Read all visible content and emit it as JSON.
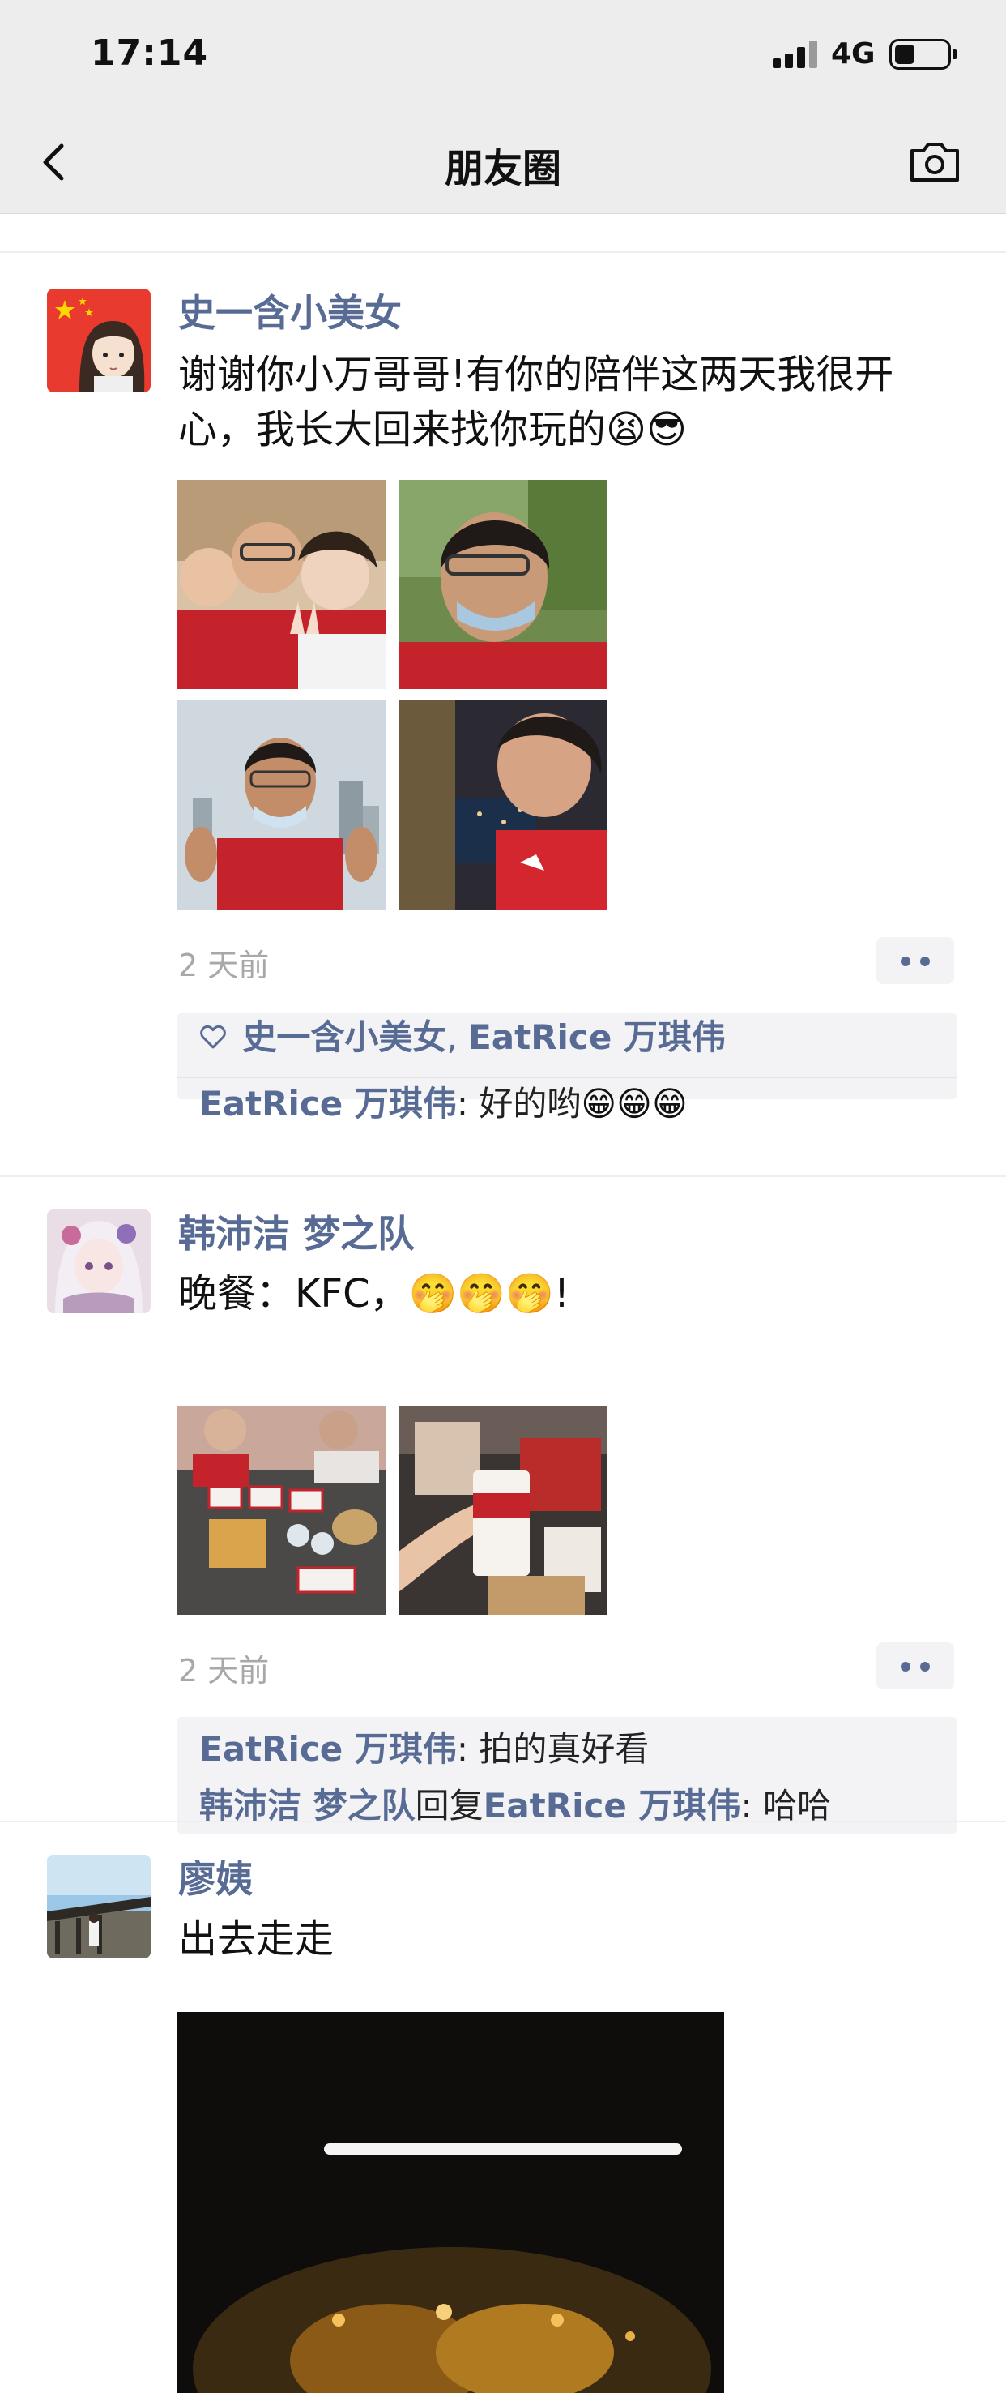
{
  "status_bar": {
    "time": "17:14",
    "network": "4G"
  },
  "nav": {
    "title": "朋友圈"
  },
  "posts": [
    {
      "name": "史一含小美女",
      "text_line1": "谢谢你小万哥哥!有你的陪伴这两天我很开",
      "text_line2": "心，我长大回来找你玩的😫😎",
      "time": "2 天前",
      "likes": {
        "name1": "史一含小美女",
        "sep": ", ",
        "name2": "EatRice 万琪伟"
      },
      "comments": [
        {
          "author": "EatRice 万琪伟",
          "text": ": 好的哟",
          "emoji": "😁😁😁"
        }
      ]
    },
    {
      "name": "韩沛洁 梦之队",
      "text": "晚餐：KFC，🤭🤭🤭!",
      "time": "2 天前",
      "comments": [
        {
          "author": "EatRice 万琪伟",
          "text": ": 拍的真好看"
        },
        {
          "author": "韩沛洁 梦之队",
          "reply_word": "回复",
          "reply_to": "EatRice 万琪伟",
          "text": ": 哈哈"
        }
      ]
    },
    {
      "name": "廖姨",
      "text": "出去走走"
    }
  ],
  "icons": {
    "back": "chevron-left-icon",
    "camera": "camera-icon",
    "like": "heart-outline-icon",
    "more": "more-dots-icon"
  },
  "colors": {
    "link": "#576b95",
    "nav_bg": "#ededed",
    "comment_bg": "#f3f3f5",
    "time": "#a8a8a8"
  }
}
